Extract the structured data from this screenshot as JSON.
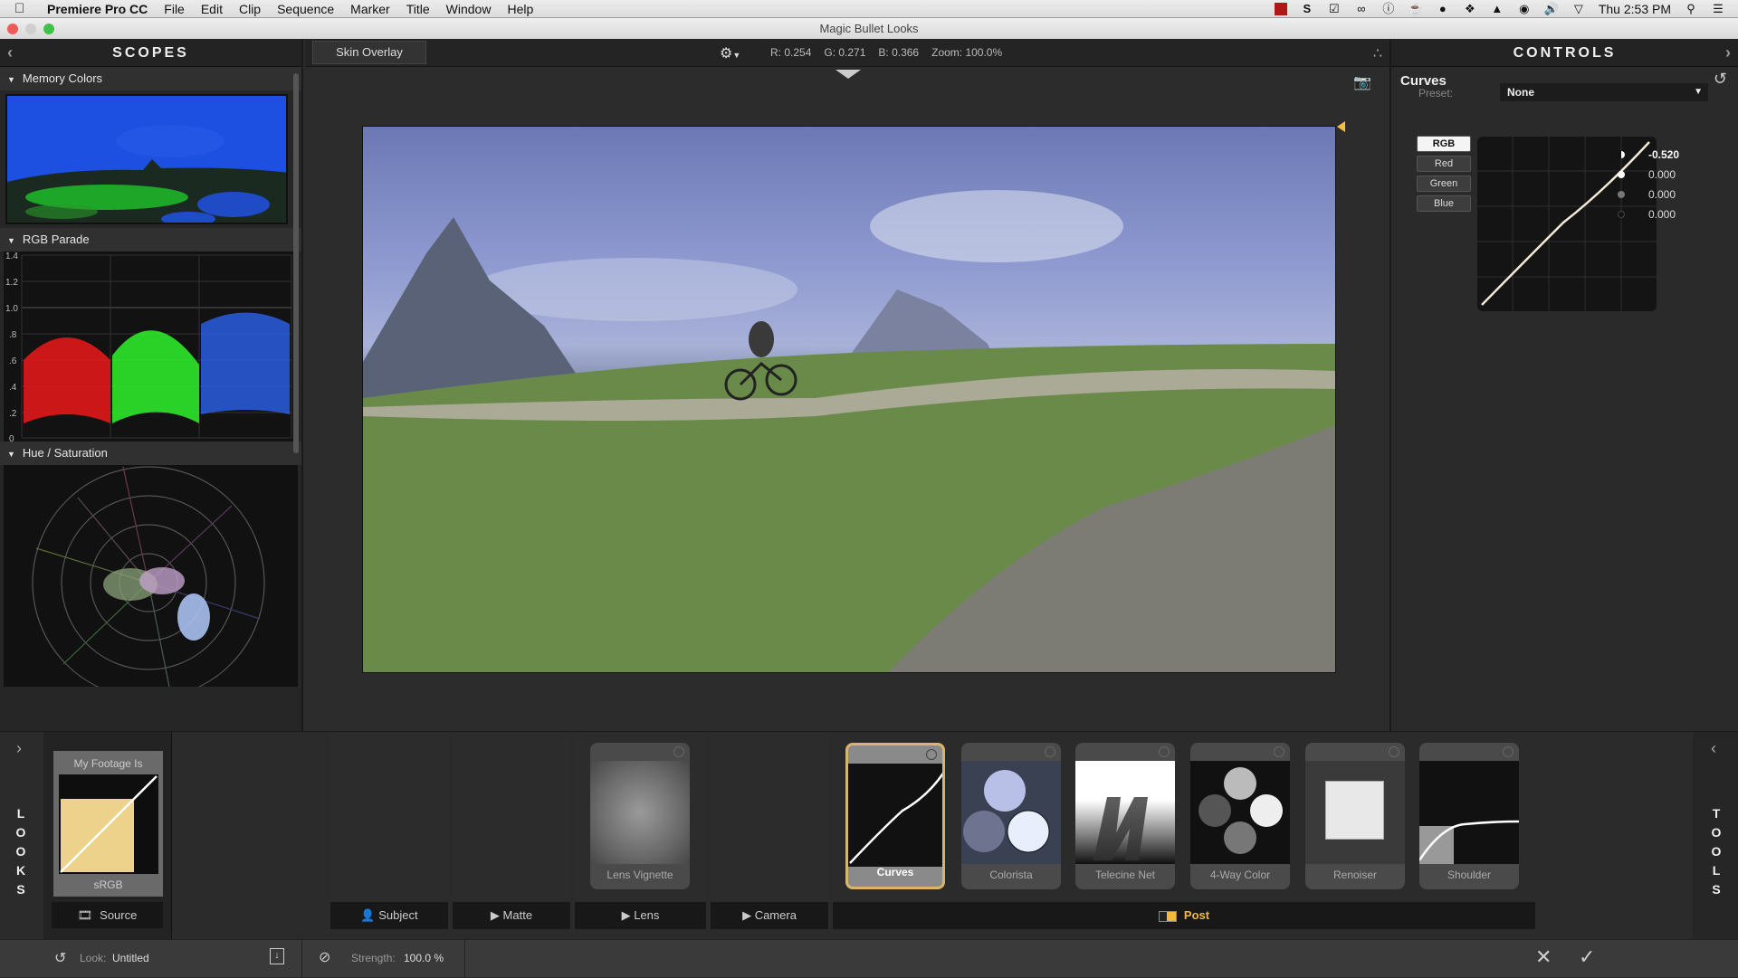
{
  "menubar": {
    "app_name": "Premiere Pro CC",
    "items": [
      "File",
      "Edit",
      "Clip",
      "Sequence",
      "Marker",
      "Title",
      "Window",
      "Help"
    ],
    "clock": "Thu 2:53 PM",
    "status_icons": [
      "film-icon",
      "s-icon",
      "check-icon",
      "creative-cloud-icon",
      "alert-icon",
      "coffee-icon",
      "ghost-icon",
      "dropbox-icon",
      "flame-icon",
      "basketball-icon",
      "volume-icon",
      "wifi-icon"
    ]
  },
  "window": {
    "title": "Magic Bullet Looks"
  },
  "scopes": {
    "title": "SCOPES",
    "sections": [
      {
        "label": "Memory Colors"
      },
      {
        "label": "RGB Parade",
        "ticks": [
          "1.4",
          "1.2",
          "1.0",
          ".8",
          ".6",
          ".4",
          ".2",
          "0"
        ]
      },
      {
        "label": "Hue / Saturation"
      }
    ]
  },
  "viewer": {
    "skin_overlay_label": "Skin Overlay",
    "readout": {
      "r": "R: 0.254",
      "g": "G: 0.271",
      "b": "B: 0.366",
      "zoom": "Zoom: 100.0%"
    }
  },
  "controls": {
    "title": "CONTROLS",
    "tool_name": "Curves",
    "preset_label": "Preset:",
    "preset_value": "None",
    "channels": [
      "RGB",
      "Red",
      "Green",
      "Blue"
    ],
    "active_channel": "RGB",
    "values": [
      "-0.520",
      "0.000",
      "0.000",
      "0.000"
    ]
  },
  "looks": {
    "side_label": [
      "L",
      "O",
      "O",
      "K",
      "S"
    ],
    "footage_title": "My Footage Is",
    "footage_value": "sRGB",
    "source_label": "Source"
  },
  "tools": {
    "side_label": [
      "T",
      "O",
      "O",
      "L",
      "S"
    ],
    "cards": [
      {
        "name": "Lens Vignette",
        "selected": false
      },
      {
        "name": "Curves",
        "selected": true
      },
      {
        "name": "Colorista",
        "selected": false
      },
      {
        "name": "Telecine Net",
        "selected": false
      },
      {
        "name": "4-Way Color",
        "selected": false
      },
      {
        "name": "Renoiser",
        "selected": false
      },
      {
        "name": "Shoulder",
        "selected": false
      }
    ],
    "categories": [
      "Subject",
      "Matte",
      "Lens",
      "Camera",
      "Post"
    ],
    "active_category": "Post"
  },
  "statusbar": {
    "look_label": "Look:",
    "look_value": "Untitled",
    "strength_label": "Strength:",
    "strength_value": "100.0 %"
  },
  "colors": {
    "accent": "#f0b840",
    "selected_card_border": "#d9b46a"
  }
}
